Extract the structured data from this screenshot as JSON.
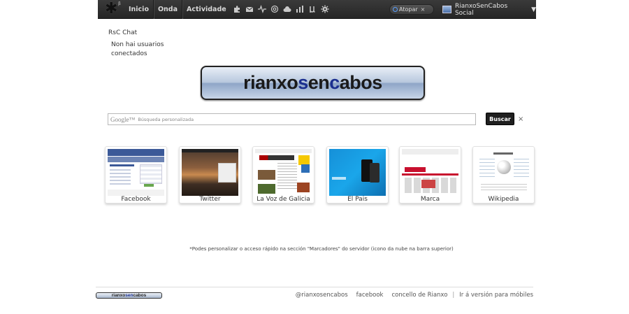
{
  "topbar": {
    "logo_glyph": "✱",
    "logo_sup": "β",
    "nav": [
      "Inicio",
      "Onda",
      "Actividade"
    ],
    "icons": [
      "puzzle-icon",
      "mail-icon",
      "activity-icon",
      "at-icon",
      "cloud-icon",
      "chart-icon",
      "mu-icon",
      "gear-icon"
    ],
    "search_label": "Atopar",
    "search_clear": "×",
    "user_name": "RianxoSenCabos Social",
    "user_caret": "▼"
  },
  "chat": {
    "title": "RsC Chat",
    "message": "Non hai usuarios conectados"
  },
  "brand": {
    "logo_text_1": "rianxo",
    "logo_text_2": "s",
    "logo_text_3": "en",
    "logo_text_4": "c",
    "logo_text_5": "abos"
  },
  "search": {
    "google_label": "Google™",
    "placeholder": "Búsqueda personalizada",
    "button_label": "Buscar",
    "clear": "×"
  },
  "speed_dial": [
    {
      "label": "Facebook"
    },
    {
      "label": "Twitter"
    },
    {
      "label": "La Voz de Galicia"
    },
    {
      "label": "El Pais"
    },
    {
      "label": "Marca"
    },
    {
      "label": "Wikipedia"
    }
  ],
  "note": "*Podes personalizar o acceso rápido na sección \"Marcadores\" do servidor (icono da nube na barra superior)",
  "footer": {
    "logo_a": "rianxo",
    "logo_b": "sen",
    "logo_c": "cabos",
    "links": [
      "@rianxosencabos",
      "facebook",
      "concello de Rianxo"
    ],
    "separator": "|",
    "mobile_link": "Ir á versión para móbiles"
  },
  "colors": {
    "topbar": "#2e2e2e",
    "button": "#1f1f1f",
    "brand_blue": "#1b2f8f"
  }
}
